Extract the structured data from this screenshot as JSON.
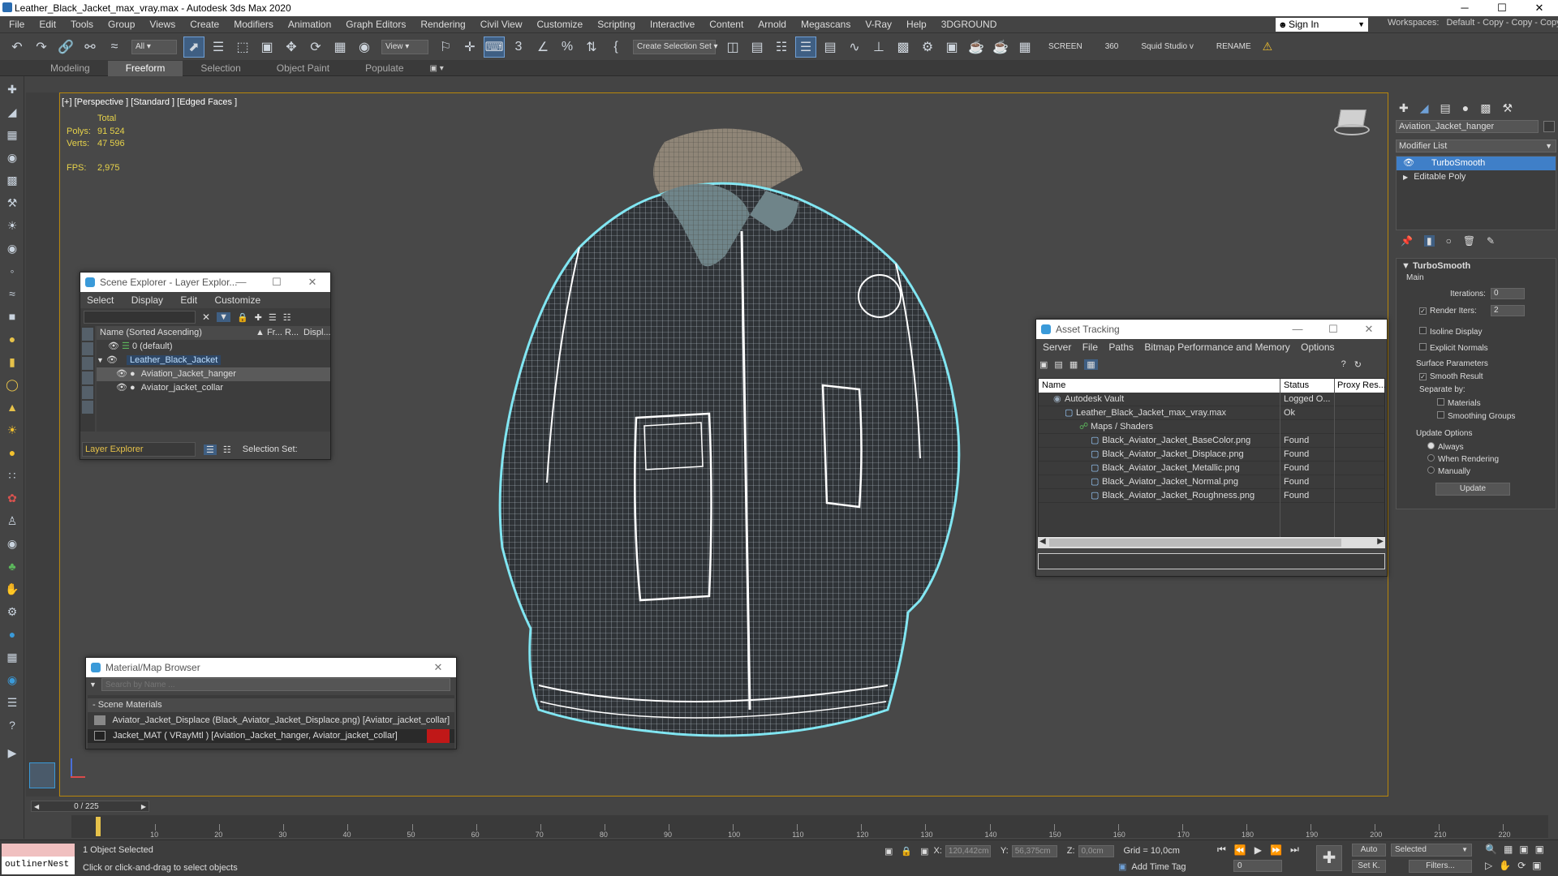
{
  "window": {
    "title": "Leather_Black_Jacket_max_vray.max - Autodesk 3ds Max 2020",
    "min": "─",
    "max": "☐",
    "close": "✕"
  },
  "menubar": {
    "items": [
      "File",
      "Edit",
      "Tools",
      "Group",
      "Views",
      "Create",
      "Modifiers",
      "Animation",
      "Graph Editors",
      "Rendering",
      "Civil View",
      "Customize",
      "Scripting",
      "Interactive",
      "Content",
      "Arnold",
      "Megascans",
      "V-Ray",
      "Help",
      "3DGROUND"
    ],
    "signin": "Sign In",
    "workspaces_label": "Workspaces:",
    "workspace_value": "Default - Copy - Copy - Copy"
  },
  "toolbar": {
    "filter_all": "All",
    "view_dropdown": "View",
    "selection_set": "Create Selection Set",
    "screen_label": "SCREEN",
    "num_360": "360",
    "squid_label": "Squid Studio v",
    "rename_label": "RENAME"
  },
  "ribbon": {
    "tabs": [
      "Modeling",
      "Freeform",
      "Selection",
      "Object Paint",
      "Populate"
    ]
  },
  "viewport": {
    "label": "[+] [Perspective ] [Standard ] [Edged Faces ]",
    "total_label": "Total",
    "polys_label": "Polys:",
    "polys_value": "91 524",
    "verts_label": "Verts:",
    "verts_value": "47 596",
    "fps_label": "FPS:",
    "fps_value": "2,975"
  },
  "scene_explorer": {
    "title": "Scene Explorer - Layer Explor...",
    "menu": [
      "Select",
      "Display",
      "Edit",
      "Customize"
    ],
    "col_name": "Name (Sorted Ascending)",
    "col_fr": "▲ Fr...",
    "col_r": "R...",
    "col_disp": "Displ...",
    "rows": [
      "0 (default)",
      "Leather_Black_Jacket",
      "Aviation_Jacket_hanger",
      "Aviator_jacket_collar"
    ],
    "footer_dropdown": "Layer Explorer",
    "selection_set": "Selection Set:"
  },
  "asset_tracking": {
    "title": "Asset Tracking",
    "menu": [
      "Server",
      "File",
      "Paths",
      "Bitmap Performance and Memory",
      "Options"
    ],
    "col_name": "Name",
    "col_status": "Status",
    "col_proxy": "Proxy Res...",
    "rows": [
      {
        "name": "Autodesk Vault",
        "status": "Logged O..."
      },
      {
        "name": "Leather_Black_Jacket_max_vray.max",
        "status": "Ok"
      },
      {
        "name": "Maps / Shaders",
        "status": ""
      },
      {
        "name": "Black_Aviator_Jacket_BaseColor.png",
        "status": "Found"
      },
      {
        "name": "Black_Aviator_Jacket_Displace.png",
        "status": "Found"
      },
      {
        "name": "Black_Aviator_Jacket_Metallic.png",
        "status": "Found"
      },
      {
        "name": "Black_Aviator_Jacket_Normal.png",
        "status": "Found"
      },
      {
        "name": "Black_Aviator_Jacket_Roughness.png",
        "status": "Found"
      }
    ]
  },
  "material_browser": {
    "title": "Material/Map Browser",
    "search_placeholder": "Search by Name ...",
    "section": "- Scene Materials",
    "rows": [
      "Aviator_Jacket_Displace (Black_Aviator_Jacket_Displace.png)  [Aviator_jacket_collar]",
      "Jacket_MAT  ( VRayMtl )  [Aviation_Jacket_hanger, Aviator_jacket_collar]"
    ]
  },
  "command_panel": {
    "object_name": "Aviation_Jacket_hanger",
    "modifier_list": "Modifier List",
    "stack": [
      "TurboSmooth",
      "Editable Poly"
    ],
    "rollout_title": "TurboSmooth",
    "main_label": "Main",
    "iterations_label": "Iterations:",
    "iterations_value": "0",
    "render_iters_label": "Render Iters:",
    "render_iters_value": "2",
    "isoline": "Isoline Display",
    "explicit_normals": "Explicit Normals",
    "surface_params": "Surface Parameters",
    "smooth_result": "Smooth Result",
    "separate_by": "Separate by:",
    "materials": "Materials",
    "smoothing_groups": "Smoothing Groups",
    "update_options": "Update Options",
    "always": "Always",
    "when_rendering": "When Rendering",
    "manually": "Manually",
    "update_button": "Update"
  },
  "timeline": {
    "frame_counter": "0 / 225",
    "ticks": [
      "10",
      "20",
      "30",
      "40",
      "50",
      "60",
      "70",
      "80",
      "90",
      "100",
      "110",
      "120",
      "130",
      "140",
      "150",
      "160",
      "170",
      "180",
      "190",
      "200",
      "210",
      "220"
    ]
  },
  "status": {
    "script_box": "outlinerNest",
    "selected": "1 Object Selected",
    "prompt": "Click or click-and-drag to select objects",
    "x_label": "X:",
    "x_value": "120,442cm",
    "y_label": "Y:",
    "y_value": "56,375cm",
    "z_label": "Z:",
    "z_value": "0,0cm",
    "grid": "Grid = 10,0cm",
    "add_time_tag": "Add Time Tag",
    "auto": "Auto",
    "selected_dropdown": "Selected",
    "set_k": "Set K.",
    "filters": "Filters...",
    "frame_value": "0"
  },
  "colors": {
    "accent": "#3a9ad9",
    "viewport_border": "#b8860b",
    "selection_outline": "#7fe6f2",
    "stat_text": "#e6d24a"
  }
}
